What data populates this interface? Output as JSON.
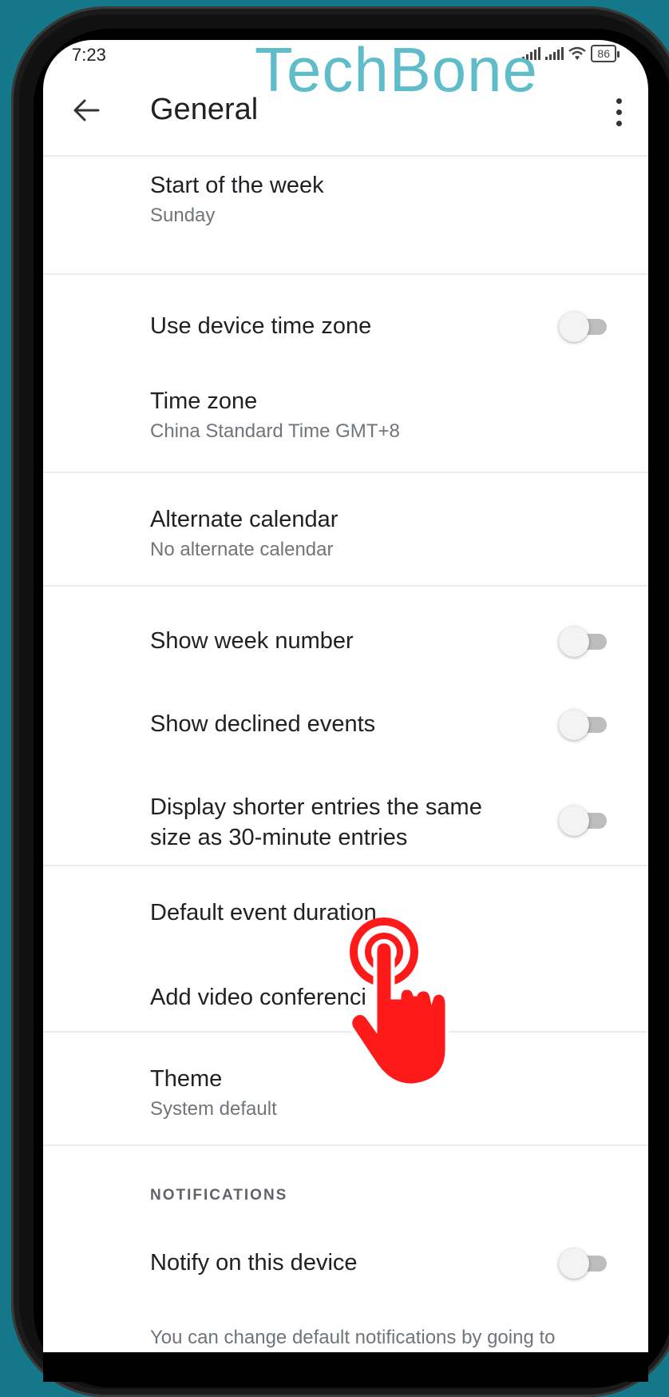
{
  "status_bar": {
    "time": "7:23",
    "battery": "86"
  },
  "watermark": "TechBone",
  "app_bar": {
    "title": "General"
  },
  "settings": {
    "start_of_week": {
      "title": "Start of the week",
      "value": "Sunday"
    },
    "use_device_time_zone": {
      "title": "Use device time zone",
      "enabled": false
    },
    "time_zone": {
      "title": "Time zone",
      "value": "China Standard Time  GMT+8"
    },
    "alternate_calendar": {
      "title": "Alternate calendar",
      "value": "No alternate calendar"
    },
    "show_week_number": {
      "title": "Show week number",
      "enabled": false
    },
    "show_declined_events": {
      "title": "Show declined events",
      "enabled": false
    },
    "shorter_entries": {
      "title_line1": "Display shorter entries the same",
      "title_line2": "size as 30-minute entries",
      "enabled": false
    },
    "default_event_duration": {
      "title": "Default event duration"
    },
    "video_conferencing": {
      "title": "Add video conferenci"
    },
    "theme": {
      "title": "Theme",
      "value": "System default"
    }
  },
  "notifications": {
    "header": "NOTIFICATIONS",
    "notify_on_device": {
      "title": "Notify on this device",
      "enabled": false
    },
    "footer": "You can change default notifications by going to"
  },
  "colors": {
    "toggle_off_track": "#bdbdbd",
    "tap_hand": "#ff1a1a",
    "background": "#15788a",
    "watermark": "#5fbdc9"
  },
  "icons": [
    "back-arrow-icon",
    "more-vert-icon",
    "signal-icon",
    "wifi-icon",
    "battery-icon",
    "tap-hand-icon"
  ]
}
